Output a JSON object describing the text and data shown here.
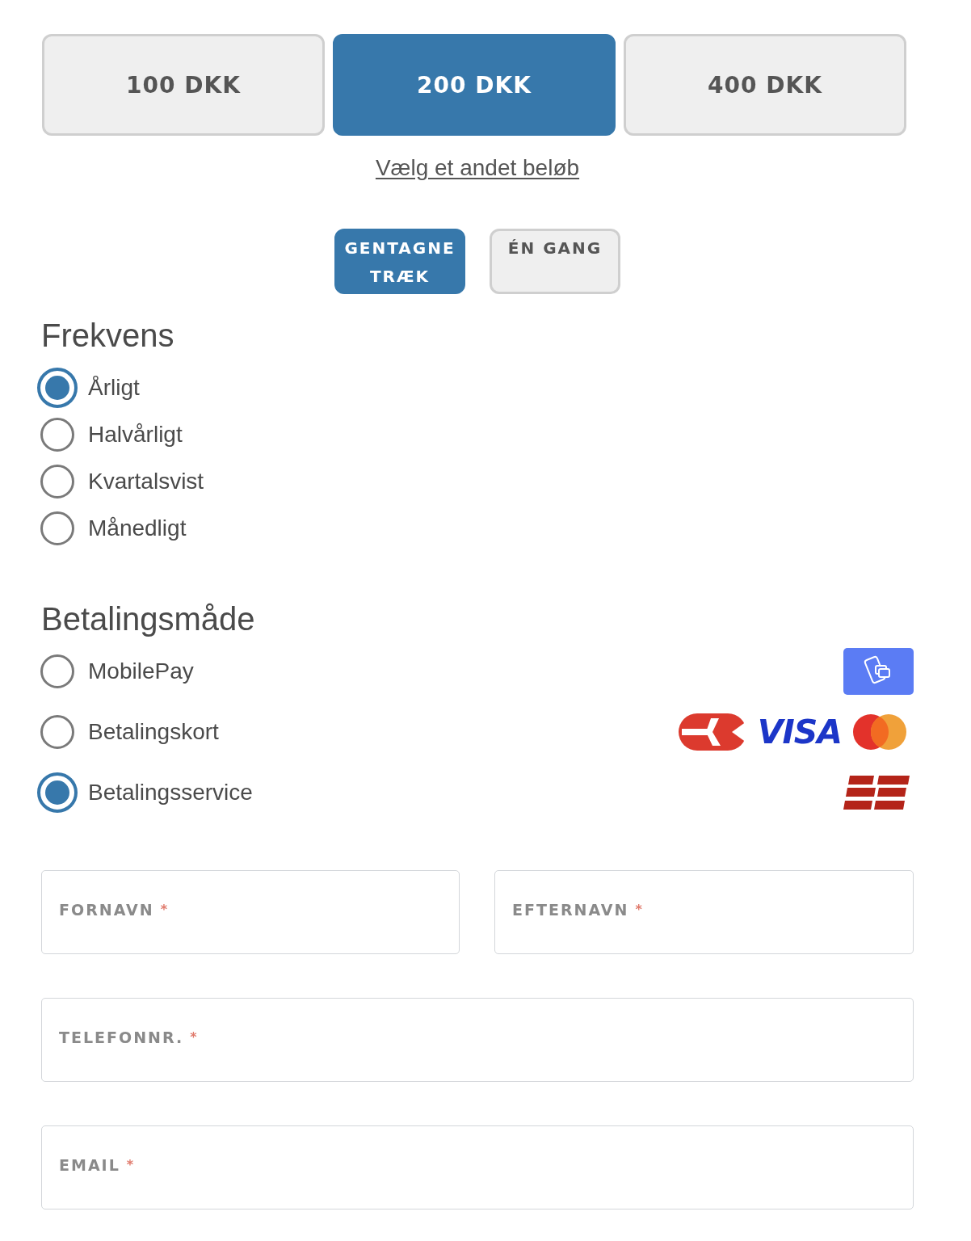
{
  "amounts": [
    {
      "label": "100 DKK",
      "selected": false
    },
    {
      "label": "200 DKK",
      "selected": true
    },
    {
      "label": "400 DKK",
      "selected": false
    }
  ],
  "other_amount_link": "Vælg et andet beløb",
  "payment_type": [
    {
      "label": "GENTAGNE TRÆK",
      "selected": true
    },
    {
      "label": "ÉN GANG",
      "selected": false
    }
  ],
  "frequency": {
    "heading": "Frekvens",
    "options": [
      {
        "label": "Årligt",
        "selected": true
      },
      {
        "label": "Halvårligt",
        "selected": false
      },
      {
        "label": "Kvartalsvist",
        "selected": false
      },
      {
        "label": "Månedligt",
        "selected": false
      }
    ]
  },
  "payment_method": {
    "heading": "Betalingsmåde",
    "options": [
      {
        "label": "MobilePay",
        "selected": false,
        "kind": "phone"
      },
      {
        "label": "Betalingskort",
        "selected": false,
        "kind": "card",
        "logo_text": "VISA"
      },
      {
        "label": "Betalingsservice",
        "selected": true,
        "kind": "service"
      }
    ]
  },
  "form_rows": [
    [
      {
        "label": "FORNAVN",
        "required_mark": "*"
      },
      {
        "label": "EFTERNAVN",
        "required_mark": "*"
      }
    ],
    [
      {
        "label": "TELEFONNR.",
        "required_mark": "*"
      }
    ],
    [
      {
        "label": "EMAIL",
        "required_mark": "*"
      }
    ]
  ]
}
